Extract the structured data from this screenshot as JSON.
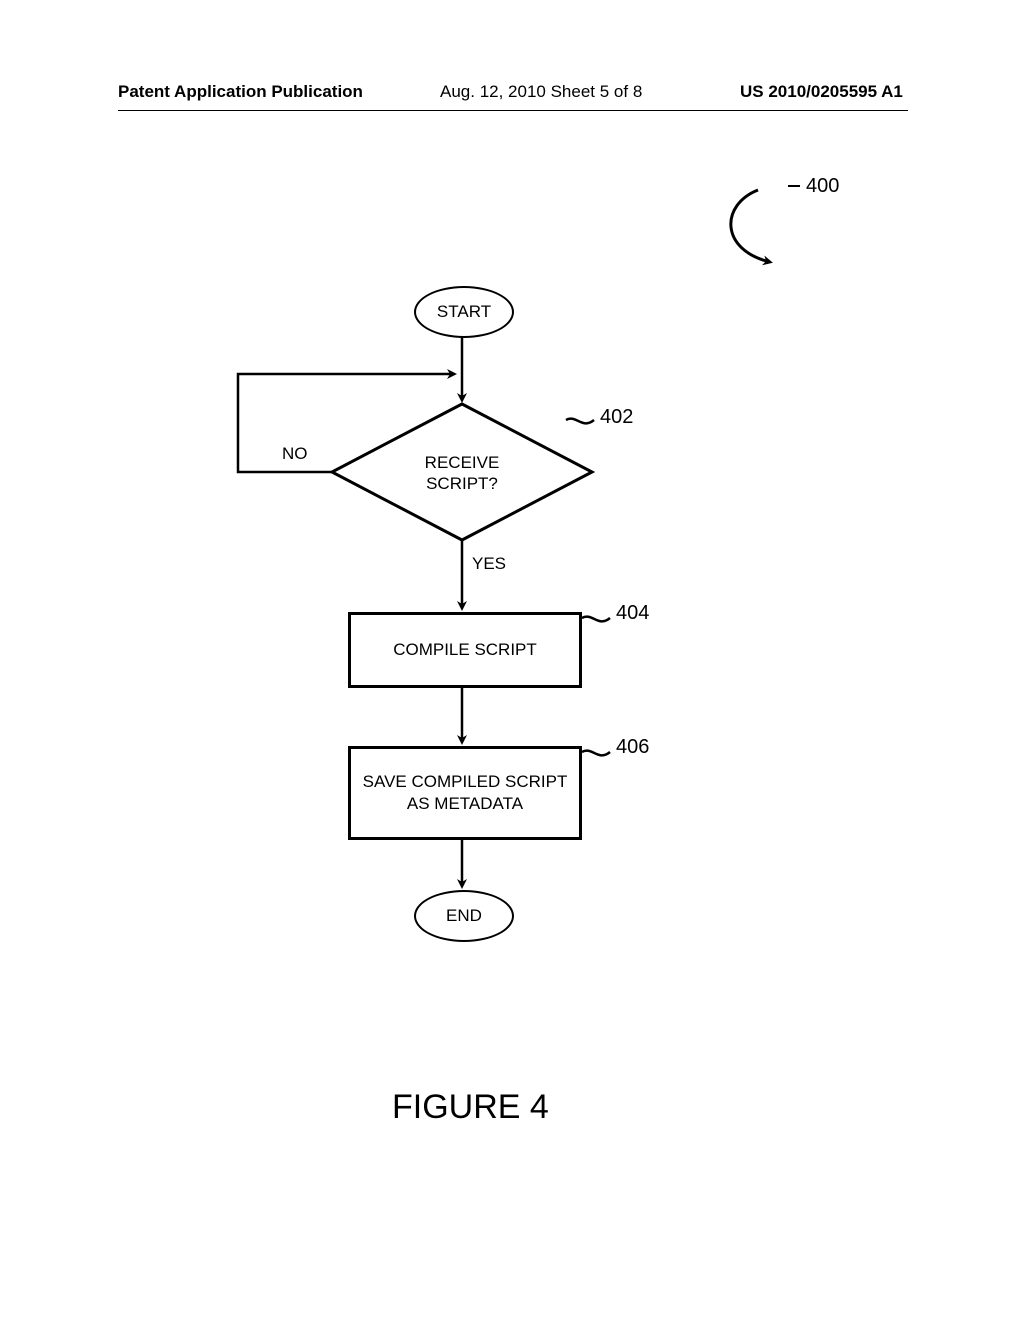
{
  "header": {
    "left": "Patent Application Publication",
    "center": "Aug. 12, 2010  Sheet 5 of 8",
    "right": "US 2010/0205595 A1"
  },
  "figure": {
    "ref": "400",
    "caption": "FIGURE 4",
    "nodes": {
      "start": "START",
      "decision": "RECEIVE SCRIPT?",
      "process1": "COMPILE SCRIPT",
      "process2": "SAVE COMPILED SCRIPT AS METADATA",
      "end": "END"
    },
    "labels": {
      "no": "NO",
      "yes": "YES",
      "ref402": "402",
      "ref404": "404",
      "ref406": "406"
    }
  }
}
